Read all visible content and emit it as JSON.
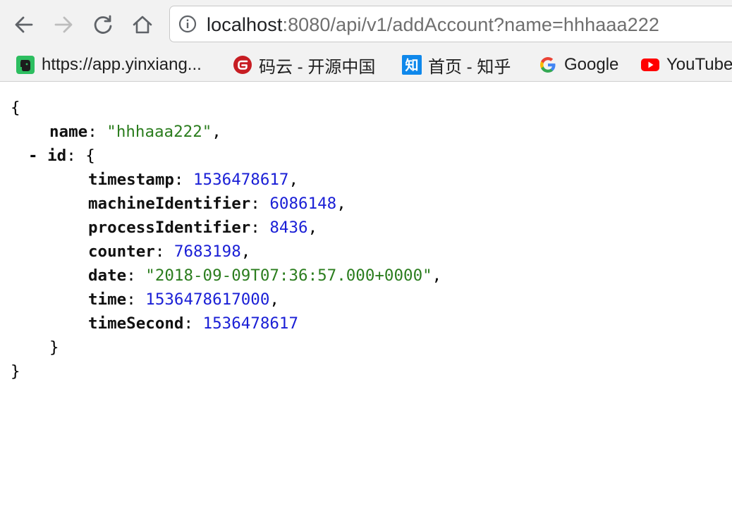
{
  "toolbar": {
    "back_icon": "arrow-left-icon",
    "forward_icon": "arrow-right-icon",
    "reload_icon": "reload-icon",
    "home_icon": "home-icon"
  },
  "address_bar": {
    "info_icon": "info-circle-icon",
    "url_host": "localhost",
    "url_rest": ":8080/api/v1/addAccount?name=hhhaaa222"
  },
  "bookmarks": [
    {
      "label": "https://app.yinxiang...",
      "icon": "evernote-icon"
    },
    {
      "label": "码云 - 开源中国",
      "icon": "gitee-icon"
    },
    {
      "label": "首页 - 知乎",
      "icon": "zhihu-icon"
    },
    {
      "label": "Google",
      "icon": "google-icon"
    },
    {
      "label": "YouTube",
      "icon": "youtube-icon"
    }
  ],
  "json": {
    "open_brace": "{",
    "close_brace": "}",
    "name_key": "name",
    "name_value": "\"hhhaaa222\"",
    "collapse_toggle": "-",
    "id_key": "id",
    "id_open": "{",
    "id_close": "}",
    "fields": [
      {
        "key": "timestamp",
        "value": "1536478617",
        "type": "number",
        "comma": ","
      },
      {
        "key": "machineIdentifier",
        "value": "6086148",
        "type": "number",
        "comma": ","
      },
      {
        "key": "processIdentifier",
        "value": "8436",
        "type": "number",
        "comma": ","
      },
      {
        "key": "counter",
        "value": "7683198",
        "type": "number",
        "comma": ","
      },
      {
        "key": "date",
        "value": "\"2018-09-09T07:36:57.000+0000\"",
        "type": "string",
        "comma": ","
      },
      {
        "key": "time",
        "value": "1536478617000",
        "type": "number",
        "comma": ","
      },
      {
        "key": "timeSecond",
        "value": "1536478617",
        "type": "number",
        "comma": ""
      }
    ]
  },
  "colors": {
    "string": "#2b7d1e",
    "number": "#1a1fd6",
    "toolbar_bg": "#f2f2f2"
  }
}
